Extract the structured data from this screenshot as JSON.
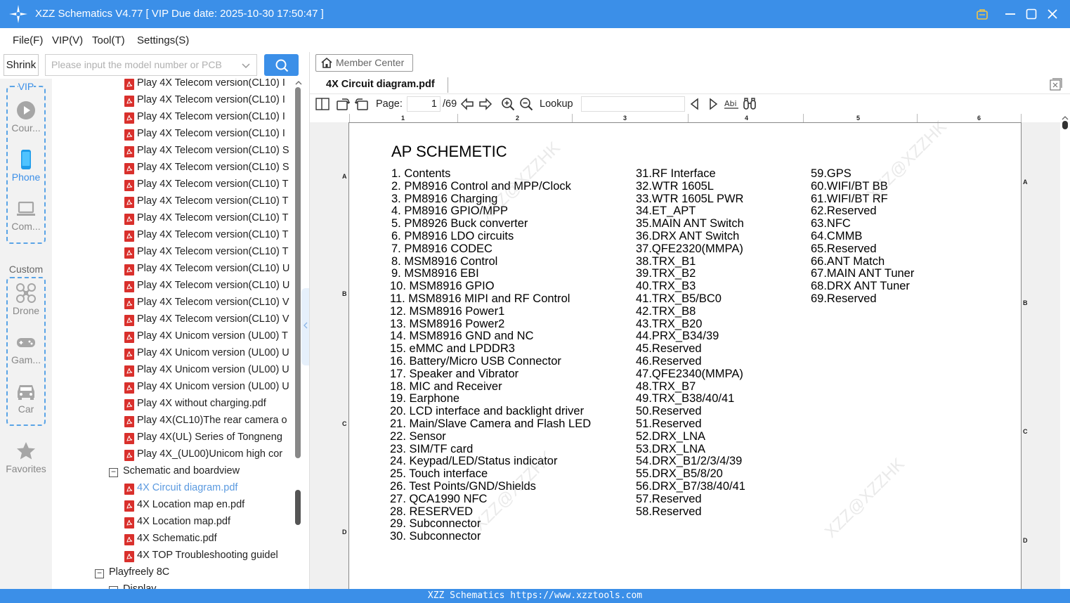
{
  "window": {
    "title": "XZZ Schematics V4.77 [ VIP Due date: 2025-10-30 17:50:47 ]"
  },
  "menu": [
    "File(F)",
    "VIP(V)",
    "Tool(T)",
    "Settings(S)"
  ],
  "search": {
    "shrink_label": "Shrink",
    "placeholder": "Please input the model number or PCB"
  },
  "categories": {
    "vip_label": "VIP",
    "custom_label": "Custom",
    "vip_items": [
      "Cour...",
      "Phone",
      "Com..."
    ],
    "custom_items": [
      "Drone",
      "Gam...",
      "Car"
    ],
    "favorites": "Favorites"
  },
  "tree": {
    "files_top": [
      "Play 4X Telecom version(CL10) I",
      "Play 4X Telecom version(CL10) I",
      "Play 4X Telecom version(CL10) I",
      "Play 4X Telecom version(CL10) I",
      "Play 4X Telecom version(CL10) S",
      "Play 4X Telecom version(CL10) S",
      "Play 4X Telecom version(CL10) T",
      "Play 4X Telecom version(CL10) T",
      "Play 4X Telecom version(CL10) T",
      "Play 4X Telecom version(CL10) T",
      "Play 4X Telecom version(CL10) T",
      "Play 4X Telecom version(CL10) U",
      "Play 4X Telecom version(CL10) U",
      "Play 4X Telecom version(CL10) V",
      "Play 4X Telecom version(CL10) V",
      "Play 4X Unicom version (UL00) T",
      "Play 4X Unicom version (UL00) U",
      "Play 4X Unicom version (UL00) U",
      "Play 4X Unicom version (UL00) U",
      "Play 4X without charging.pdf",
      "Play 4X(CL10)The rear camera o",
      "Play 4X(UL) Series of Tongneng",
      "Play 4X_(UL00)Unicom high cor"
    ],
    "folder_schematic": "Schematic and boardview",
    "folder_files": [
      "4X Circuit diagram.pdf",
      "4X Location map en.pdf",
      "4X Location map.pdf",
      "4X Schematic.pdf",
      "4X TOP Troubleshooting guidel"
    ],
    "folder_next": "Playfreely 8C",
    "folder_partial": "Display ..."
  },
  "viewer": {
    "member_center": "Member Center",
    "tab_title": "4X Circuit diagram.pdf",
    "page_label": "Page:",
    "page_current": "1",
    "page_total": "/69",
    "lookup_label": "Lookup",
    "ruler_numbers": [
      "1",
      "2",
      "3",
      "4",
      "5",
      "6"
    ],
    "left_letters": [
      "A",
      "B",
      "C",
      "D"
    ],
    "right_letters": [
      "A",
      "B",
      "C",
      "D"
    ],
    "doc_title": "AP SCHEMETIC",
    "col1": [
      "1. Contents",
      "2. PM8916 Control and MPP/Clock",
      "3. PM8916 Charging",
      "4. PM8916 GPIO/MPP",
      "5. PM8926 Buck converter",
      "6. PM8916 LDO circuits",
      "7. PM8916 CODEC",
      "8. MSM8916 Control",
      "9. MSM8916 EBI",
      "10. MSM8916 GPIO",
      "11. MSM8916 MIPI and RF Control",
      "12. MSM8916 Power1",
      "13. MSM8916 Power2",
      "14. MSM8916 GND and NC",
      "15. eMMC and LPDDR3",
      "16. Battery/Micro USB Connector",
      "17. Speaker and Vibrator",
      "18. MIC and Receiver",
      "19. Earphone",
      "20. LCD interface and backlight driver",
      "21. Main/Slave Camera and Flash LED",
      "22. Sensor",
      "23. SIM/TF card",
      "24. Keypad/LED/Status indicator",
      "25. Touch interface",
      "26. Test Points/GND/Shields",
      "27. QCA1990 NFC",
      "28. RESERVED",
      "29. Subconnector",
      "30. Subconnector"
    ],
    "col2": [
      "31.RF Interface",
      "32.WTR 1605L",
      "33.WTR 1605L PWR",
      "34.ET_APT",
      "35.MAIN ANT Switch",
      "36.DRX ANT Switch",
      "37.QFE2320(MMPA)",
      "38.TRX_B1",
      "39.TRX_B2",
      "40.TRX_B3",
      "41.TRX_B5/BC0",
      "42.TRX_B8",
      "43.TRX_B20",
      "44.PRX_B34/39",
      "45.Reserved",
      "46.Reserved",
      "47.QFE2340(MMPA)",
      "48.TRX_B7",
      "49.TRX_B38/40/41",
      "50.Reserved",
      "51.Reserved",
      "52.DRX_LNA",
      "53.DRX_LNA",
      "54.DRX_B1/2/3/4/39",
      "55.DRX_B5/8/20",
      "56.DRX_B7/38/40/41",
      "57.Reserved",
      "58.Reserved"
    ],
    "col3": [
      "59.GPS",
      "60.WIFI/BT BB",
      "61.WIFI/BT RF",
      "62.Reserved",
      "63.NFC",
      "64.CMMB",
      "65.Reserved",
      "66.ANT Match",
      "67.MAIN ANT Tuner",
      "68.DRX ANT Tuner",
      "69.Reserved"
    ],
    "watermark": "XZZ@XZZHK"
  },
  "status": {
    "text": "XZZ Schematics https://www.xzztools.com"
  },
  "colors": {
    "accent": "#3b8fe8",
    "pdf_red": "#d9302c",
    "selected_link": "#5b9ae0"
  }
}
